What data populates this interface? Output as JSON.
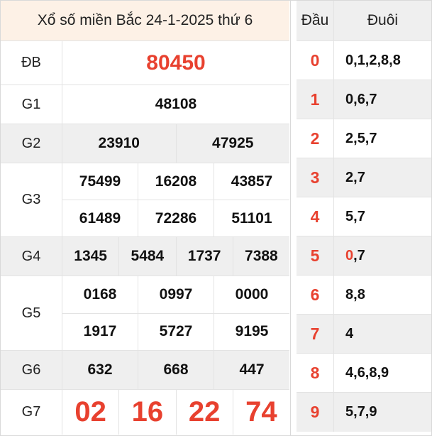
{
  "title": "Xổ số miền Bắc 24-1-2025 thứ 6",
  "prizes": {
    "db": {
      "label": "ĐB",
      "numbers": [
        "80450"
      ]
    },
    "g1": {
      "label": "G1",
      "numbers": [
        "48108"
      ]
    },
    "g2": {
      "label": "G2",
      "numbers": [
        "23910",
        "47925"
      ]
    },
    "g3": {
      "label": "G3",
      "numbers": [
        "75499",
        "16208",
        "43857",
        "61489",
        "72286",
        "51101"
      ]
    },
    "g4": {
      "label": "G4",
      "numbers": [
        "1345",
        "5484",
        "1737",
        "7388"
      ]
    },
    "g5": {
      "label": "G5",
      "numbers": [
        "0168",
        "0997",
        "0000",
        "1917",
        "5727",
        "9195"
      ]
    },
    "g6": {
      "label": "G6",
      "numbers": [
        "632",
        "668",
        "447"
      ]
    },
    "g7": {
      "label": "G7",
      "numbers": [
        "02",
        "16",
        "22",
        "74"
      ]
    }
  },
  "loto": {
    "header_dau": "Đầu",
    "header_duoi": "Đuôi",
    "rows": [
      {
        "dau": "0",
        "duoi": "1,2,8,8",
        "duoi_prefix": "0,",
        "highlight_prefix": false
      },
      {
        "dau": "1",
        "duoi": "6,7",
        "duoi_prefix": "0,",
        "highlight_prefix": false
      },
      {
        "dau": "2",
        "duoi": "5,7",
        "duoi_prefix": "2,",
        "highlight_prefix": false
      },
      {
        "dau": "3",
        "duoi": "7",
        "duoi_prefix": "2,",
        "highlight_prefix": false
      },
      {
        "dau": "4",
        "duoi": "7",
        "duoi_prefix": "5,",
        "highlight_prefix": false
      },
      {
        "dau": "5",
        "duoi": ",7",
        "duoi_prefix": "0",
        "highlight_prefix": true
      },
      {
        "dau": "6",
        "duoi": "8",
        "duoi_prefix": "8,",
        "highlight_prefix": false
      },
      {
        "dau": "7",
        "duoi": "",
        "duoi_prefix": "4",
        "highlight_prefix": false
      },
      {
        "dau": "8",
        "duoi": "6,8,9",
        "duoi_prefix": "4,",
        "highlight_prefix": false
      },
      {
        "dau": "9",
        "duoi": "7,9",
        "duoi_prefix": "5,",
        "highlight_prefix": false
      }
    ]
  },
  "colors": {
    "accent_red": "#e8412f",
    "title_bg": "#fdf1e6",
    "stripe_bg": "#efefef"
  }
}
